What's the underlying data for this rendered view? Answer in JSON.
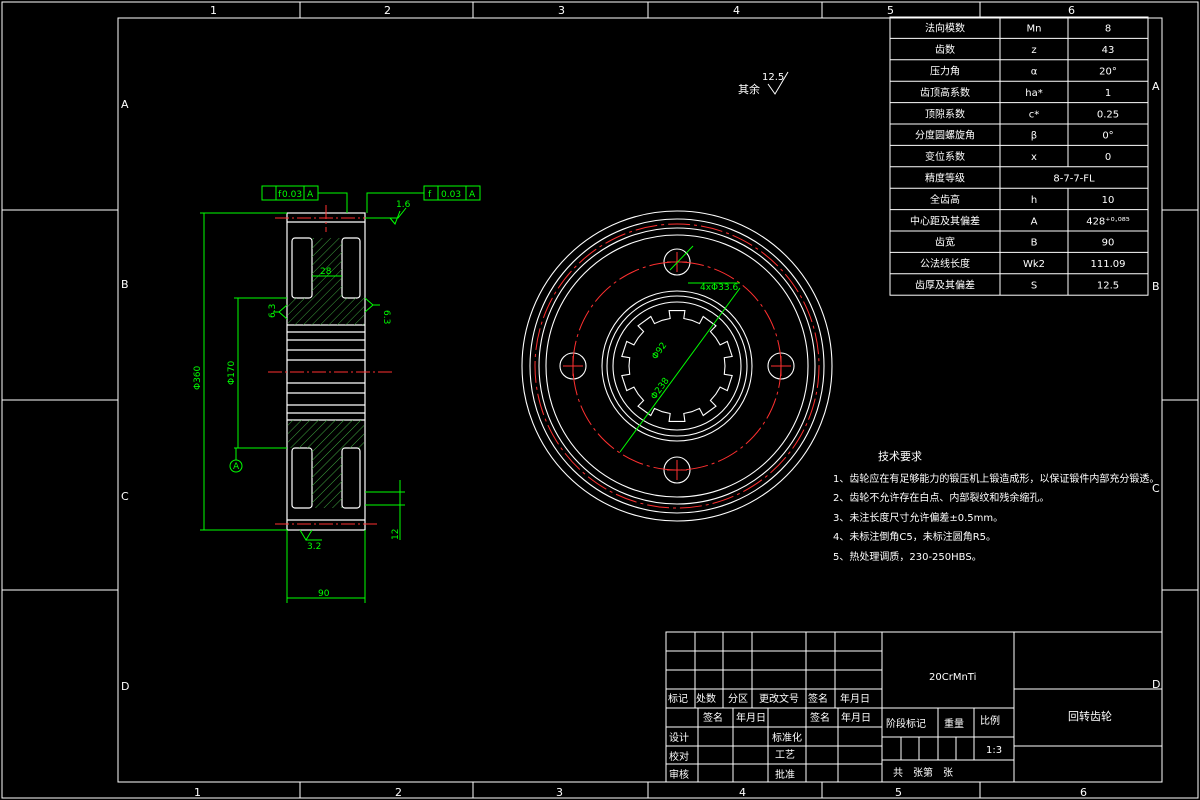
{
  "border": {
    "top_zones": [
      "1",
      "2",
      "3",
      "4",
      "5",
      "6"
    ],
    "bottom_zones": [
      "1",
      "2",
      "3",
      "4",
      "5",
      "6"
    ],
    "left_zones": [
      "A",
      "B",
      "C",
      "D"
    ],
    "right_zones": [
      "A",
      "B",
      "C",
      "D"
    ]
  },
  "params_table": [
    {
      "name": "法向模数",
      "symbol": "Mn",
      "value": "8"
    },
    {
      "name": "齿数",
      "symbol": "z",
      "value": "43"
    },
    {
      "name": "压力角",
      "symbol": "α",
      "value": "20°"
    },
    {
      "name": "齿顶高系数",
      "symbol": "ha*",
      "value": "1"
    },
    {
      "name": "顶隙系数",
      "symbol": "c*",
      "value": "0.25"
    },
    {
      "name": "分度圆螺旋角",
      "symbol": "β",
      "value": "0°"
    },
    {
      "name": "变位系数",
      "symbol": "x",
      "value": "0"
    },
    {
      "name": "精度等级",
      "symbol": "",
      "value": "8-7-7-FL"
    },
    {
      "name": "全齿高",
      "symbol": "h",
      "value": "10"
    },
    {
      "name": "中心距及其偏差",
      "symbol": "A",
      "value": "428⁺⁰·⁰⁸⁵"
    },
    {
      "name": "齿宽",
      "symbol": "B",
      "value": "90"
    },
    {
      "name": "公法线长度",
      "symbol": "Wk2",
      "value": "111.09"
    },
    {
      "name": "齿厚及其偏差",
      "symbol": "S",
      "value": "12.5"
    }
  ],
  "roughness_note": {
    "label": "其余",
    "value": "12.5"
  },
  "side_view": {
    "tol_left": {
      "sym": "f",
      "val": "0.03",
      "datum": "A"
    },
    "tol_right": {
      "sym": "f",
      "val": "0.03",
      "datum": "A"
    },
    "rough_top": "1.6",
    "rough_left": "6.3",
    "rough_right": "6.3",
    "rough_bottom": "3.2",
    "dim_inner": "28",
    "dim_outer_dia": "Φ360",
    "dim_hub_dia": "Φ170",
    "datum_label": "A",
    "dim_width": "90",
    "dim_small": "12"
  },
  "front_view": {
    "holes_label": "4xΦ33.6",
    "spline_label": "Φ92",
    "bore_label": "Φ238"
  },
  "tech_req": {
    "title": "技术要求",
    "items": [
      "1、齿轮应在有足够能力的锻压机上锻造成形，以保证锻件内部充分锻透。",
      "2、齿轮不允许存在白点、内部裂纹和残余缩孔。",
      "3、未注长度尺寸允许偏差±0.5mm。",
      "4、未标注倒角C5，未标注圆角R5。",
      "5、热处理调质，230-250HBS。"
    ]
  },
  "title_block": {
    "material": "20CrMnTi",
    "part_name": "回转齿轮",
    "rev_headers": [
      "标记",
      "处数",
      "分区",
      "更改文号",
      "签名",
      "年月日"
    ],
    "row2": [
      "签名",
      "年月日",
      "签名",
      "年月日"
    ],
    "stage_headers": [
      "阶段标记",
      "重量",
      "比例"
    ],
    "scale": "1:3",
    "left_labels": [
      "设计",
      "校对",
      "审核"
    ],
    "mid_labels": [
      "标准化",
      "工艺",
      "批准"
    ],
    "sheets": "共　张第　张"
  }
}
